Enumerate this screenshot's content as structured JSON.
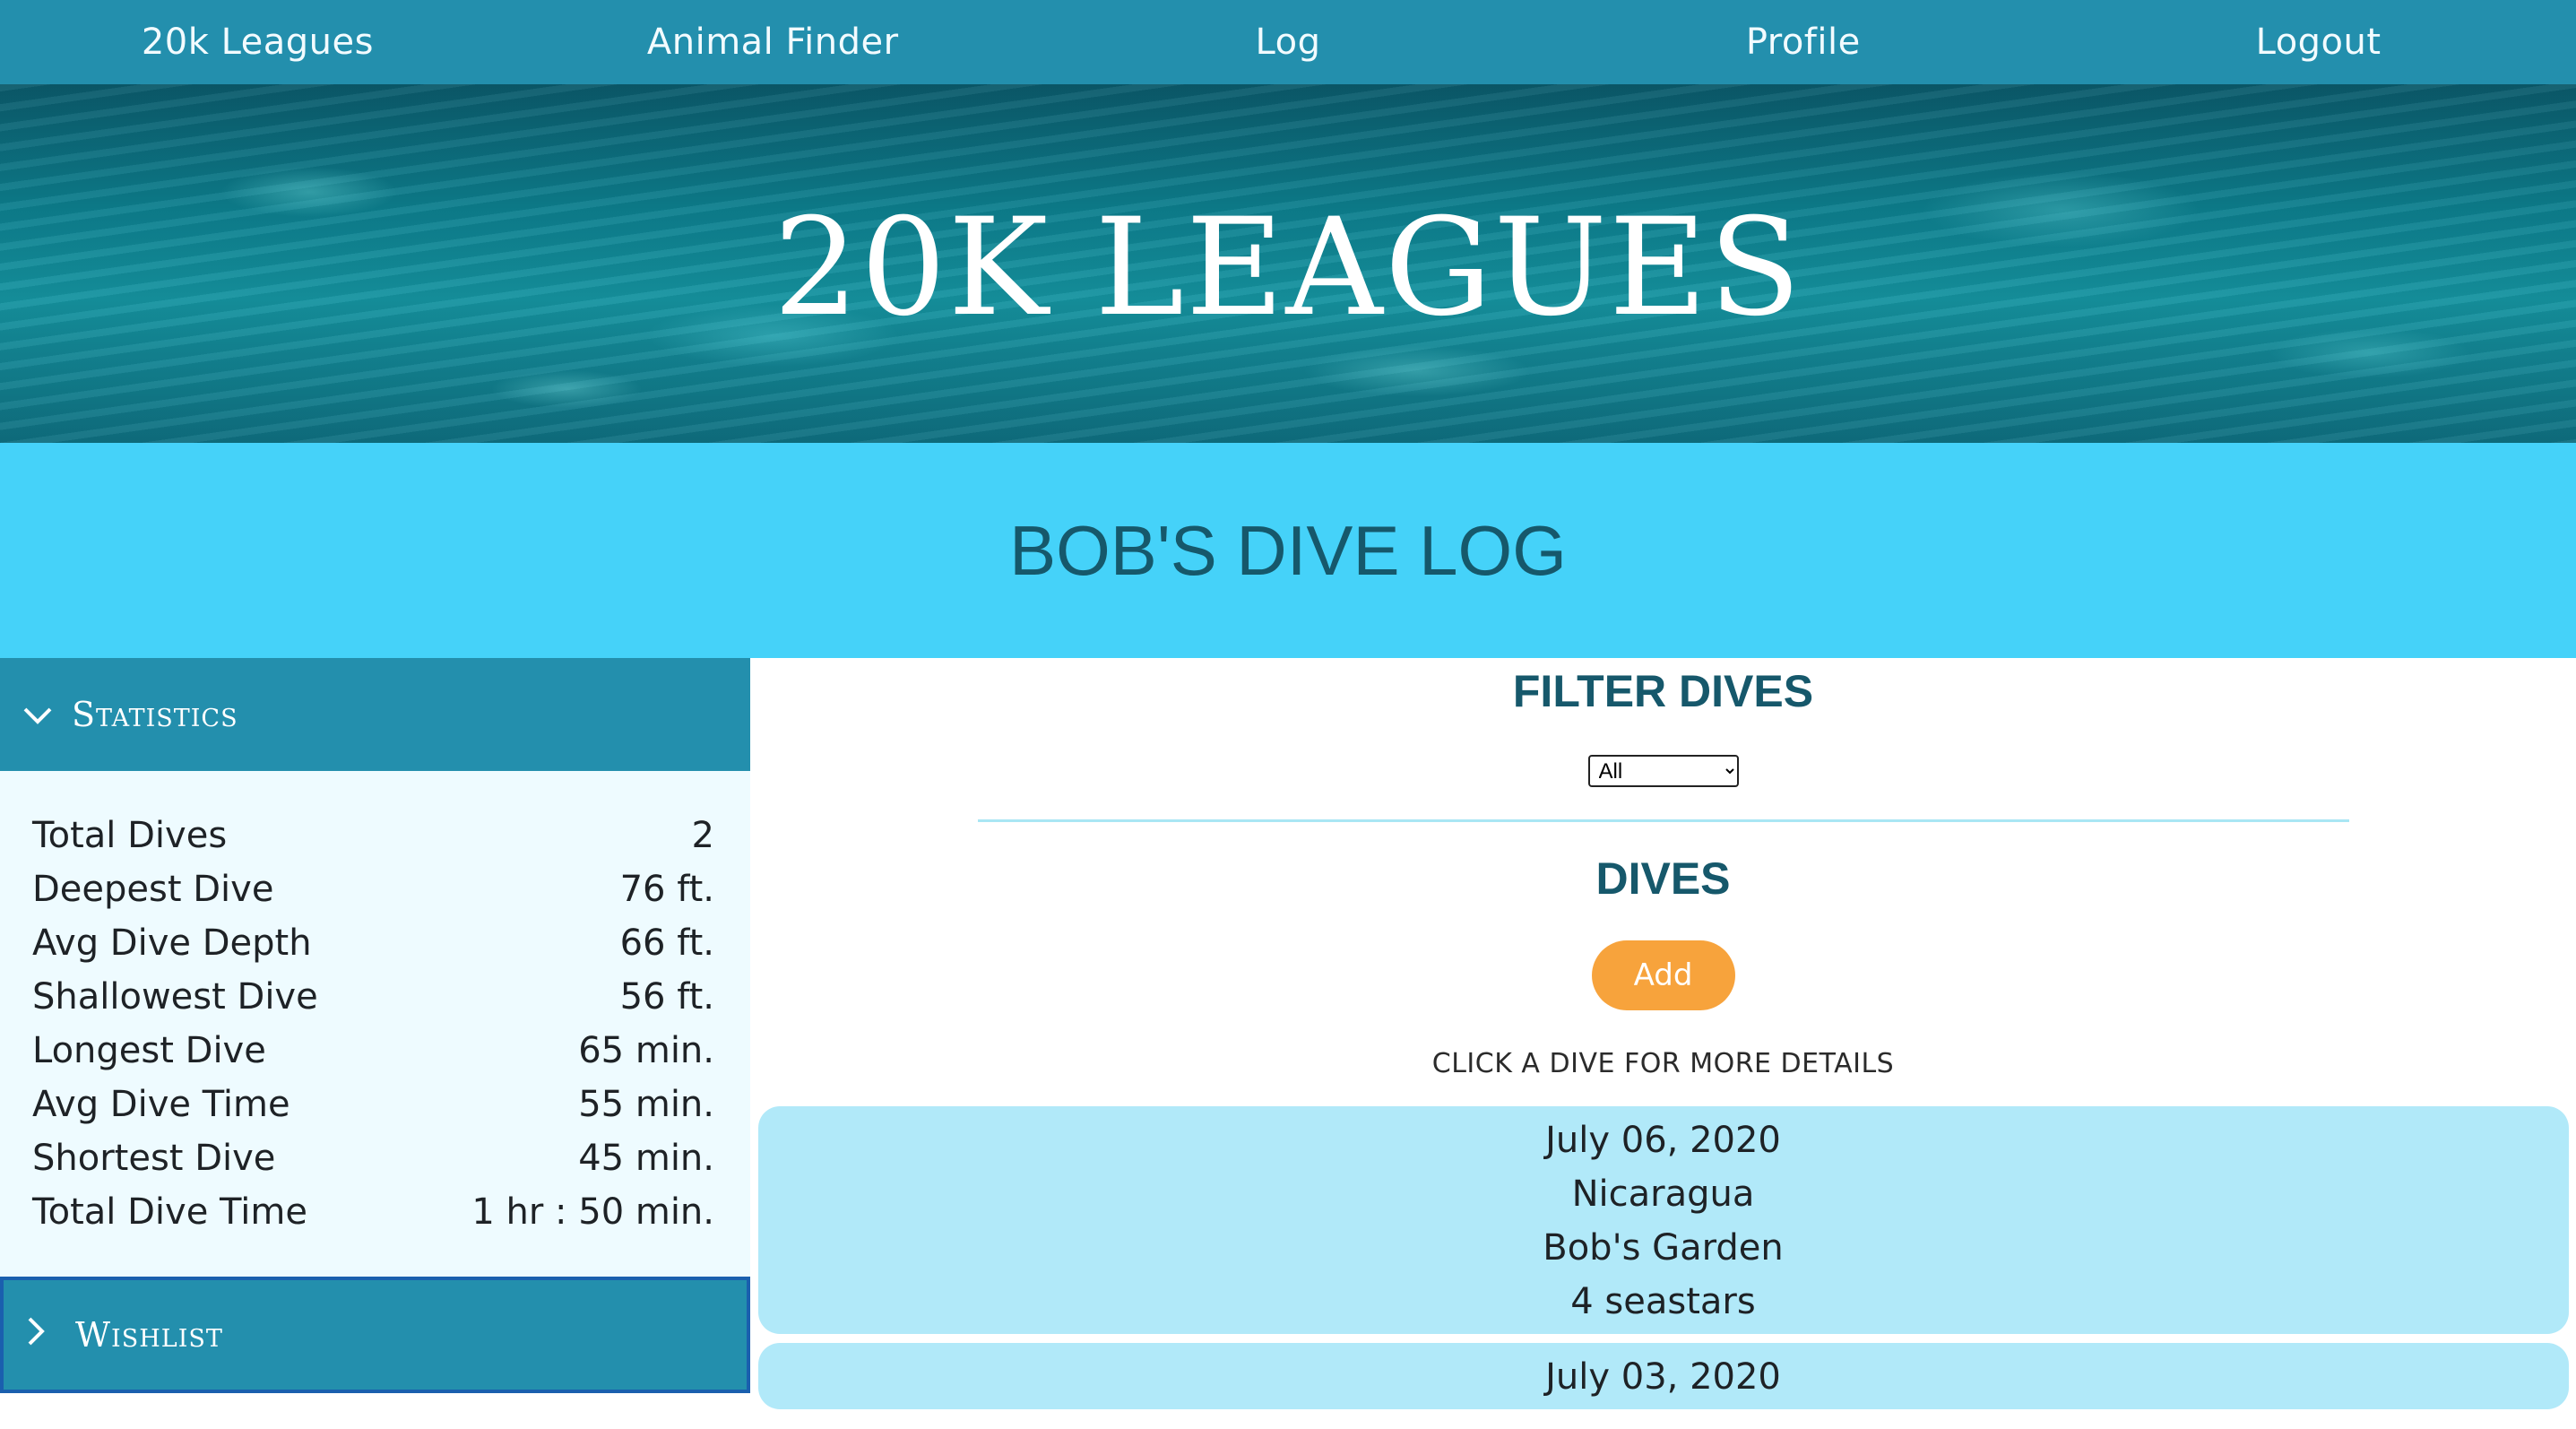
{
  "nav": {
    "items": [
      "20k Leagues",
      "Animal Finder",
      "Log",
      "Profile",
      "Logout"
    ]
  },
  "hero": {
    "title": "20K LEAGUES"
  },
  "page_title": "BOB'S DIVE LOG",
  "sidebar": {
    "statistics_label": "Statistics",
    "stats": [
      {
        "label": "Total Dives",
        "value": "2"
      },
      {
        "label": "Deepest Dive",
        "value": "76 ft."
      },
      {
        "label": "Avg Dive Depth",
        "value": "66 ft."
      },
      {
        "label": "Shallowest Dive",
        "value": "56 ft."
      },
      {
        "label": "Longest Dive",
        "value": "65 min."
      },
      {
        "label": "Avg Dive Time",
        "value": "55 min."
      },
      {
        "label": "Shortest Dive",
        "value": "45 min."
      },
      {
        "label": "Total Dive Time",
        "value": "1 hr : 50 min."
      }
    ],
    "wishlist_label": "Wishlist"
  },
  "filter": {
    "heading": "FILTER DIVES",
    "selected": "All"
  },
  "dives": {
    "heading": "DIVES",
    "add_label": "Add",
    "hint": "CLICK A DIVE FOR MORE DETAILS",
    "items": [
      {
        "date": "July 06, 2020",
        "location": "Nicaragua",
        "site": "Bob's Garden",
        "animals": "4 seastars"
      },
      {
        "date": "July 03, 2020"
      }
    ]
  },
  "colors": {
    "nav": "#238fad",
    "banner": "#45d2f9",
    "title_text": "#16586b",
    "add_button": "#f7a33c",
    "dive_card": "#b1e9f9",
    "stats_bg": "#eefbff"
  }
}
